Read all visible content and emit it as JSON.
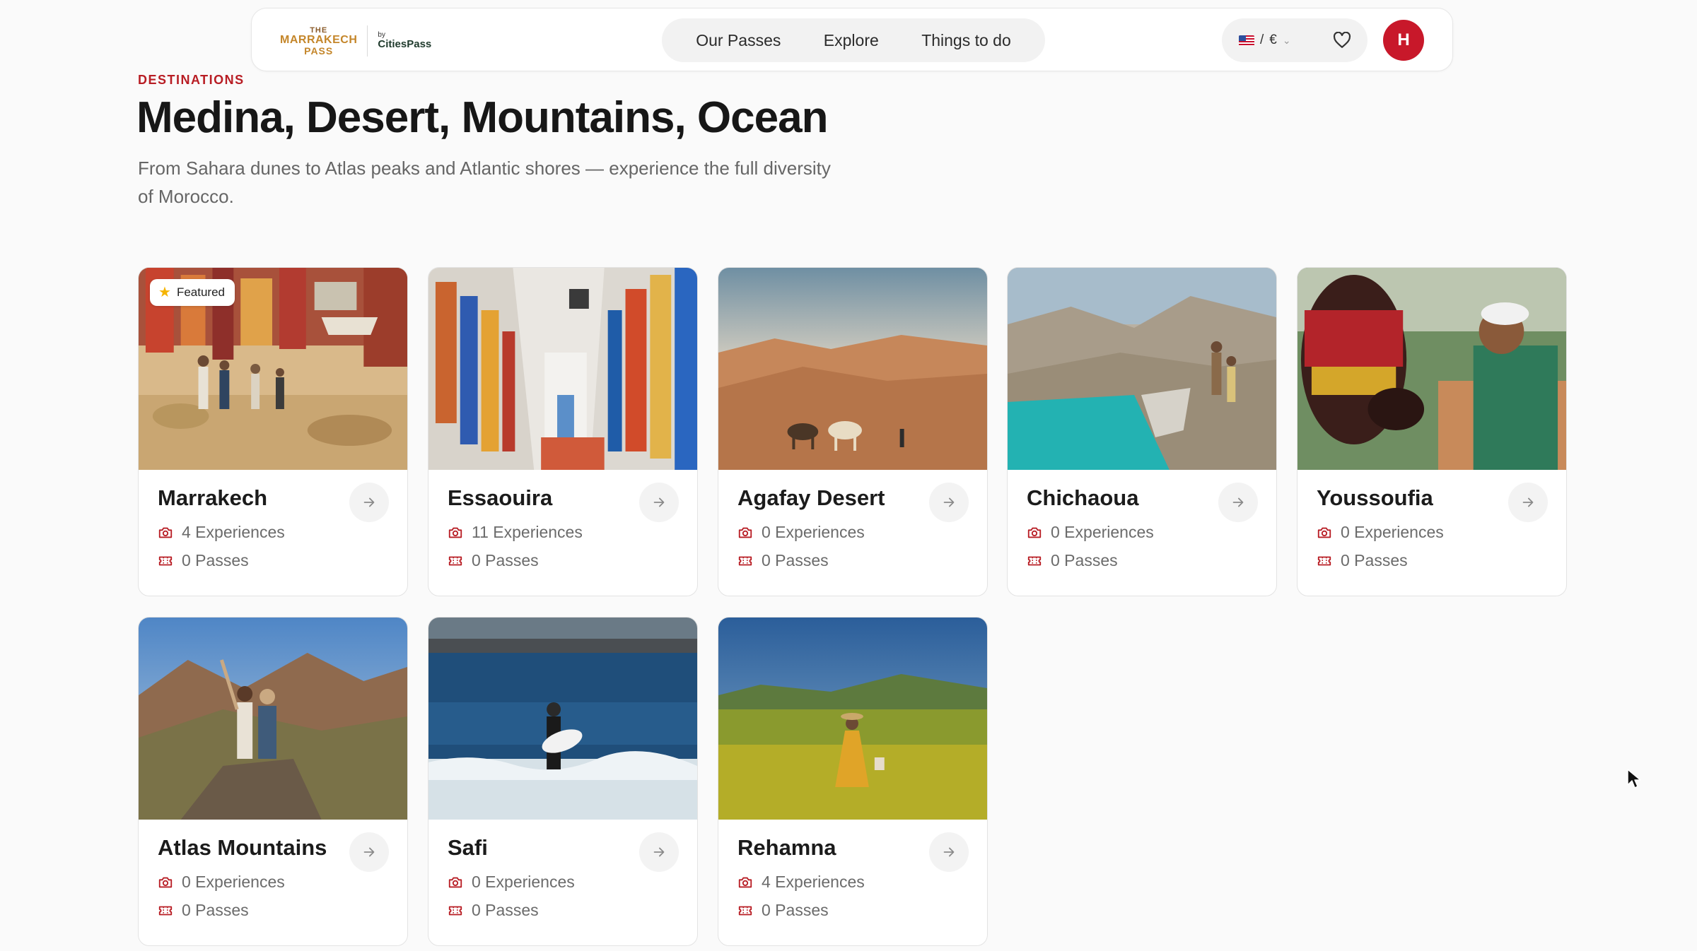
{
  "header": {
    "logo": {
      "line1": "THE",
      "line2": "MARRAKECH",
      "line3": "PASS",
      "by": "by",
      "brand": "CitiesPass"
    },
    "nav": [
      "Our Passes",
      "Explore",
      "Things to do"
    ],
    "locale": {
      "separator": "/",
      "currency": "€"
    },
    "avatar_initial": "H"
  },
  "hero": {
    "eyebrow": "DESTINATIONS",
    "title": "Medina, Desert, Mountains, Ocean",
    "subtitle": "From Sahara dunes to Atlas peaks and Atlantic shores — experience the full diversity of Morocco."
  },
  "cards": [
    {
      "name": "Marrakech",
      "experiences": "4 Experiences",
      "passes": "0 Passes",
      "badge": "Featured",
      "scene": "market"
    },
    {
      "name": "Essaouira",
      "experiences": "11 Experiences",
      "passes": "0 Passes",
      "scene": "alley"
    },
    {
      "name": "Agafay Desert",
      "experiences": "0 Experiences",
      "passes": "0 Passes",
      "scene": "desert"
    },
    {
      "name": "Chichaoua",
      "experiences": "0 Experiences",
      "passes": "0 Passes",
      "scene": "lake"
    },
    {
      "name": "Youssoufia",
      "experiences": "0 Experiences",
      "passes": "0 Passes",
      "scene": "horse"
    },
    {
      "name": "Atlas Mountains",
      "experiences": "0 Experiences",
      "passes": "0 Passes",
      "scene": "mountains"
    },
    {
      "name": "Safi",
      "experiences": "0 Experiences",
      "passes": "0 Passes",
      "scene": "ocean"
    },
    {
      "name": "Rehamna",
      "experiences": "4 Experiences",
      "passes": "0 Passes",
      "scene": "meadow"
    }
  ],
  "colors": {
    "accent": "#b81d24",
    "avatar": "#c8182a"
  }
}
